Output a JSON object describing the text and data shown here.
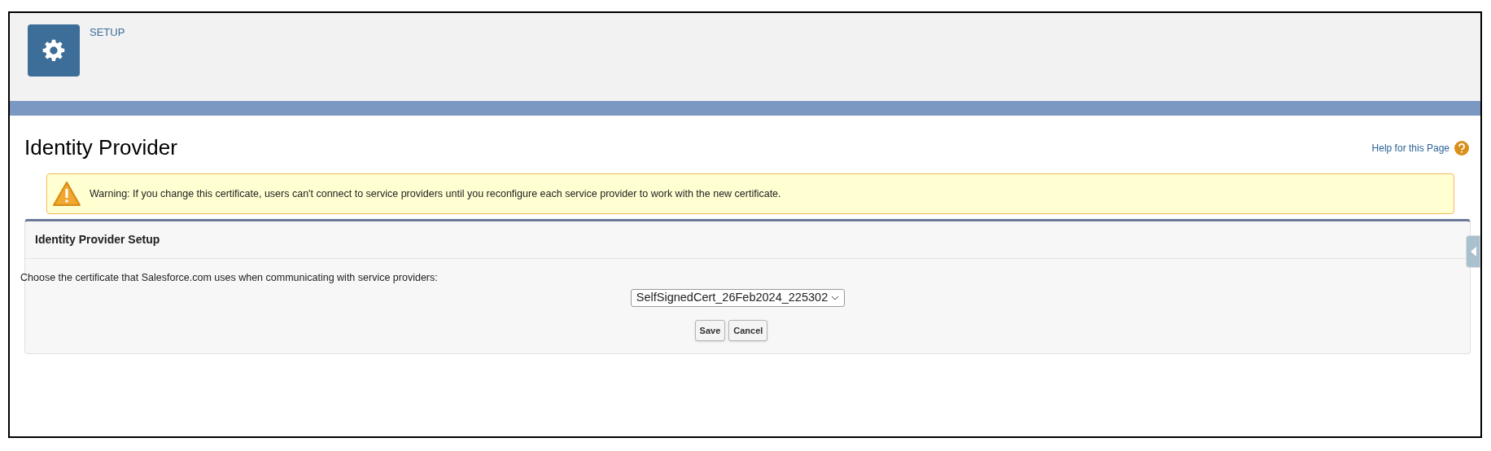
{
  "header": {
    "app_label": "SETUP"
  },
  "page": {
    "title": "Identity Provider",
    "help_link": "Help for this Page"
  },
  "warning": {
    "message": "Warning: If you change this certificate, users can't connect to service providers until you reconfigure each service provider to work with the new certificate."
  },
  "section": {
    "title": "Identity Provider Setup",
    "prompt": "Choose the certificate that Salesforce.com uses when communicating with service providers:",
    "certificate_select": {
      "value": "SelfSignedCert_26Feb2024_225302"
    },
    "buttons": [
      "Save",
      "Cancel"
    ]
  }
}
